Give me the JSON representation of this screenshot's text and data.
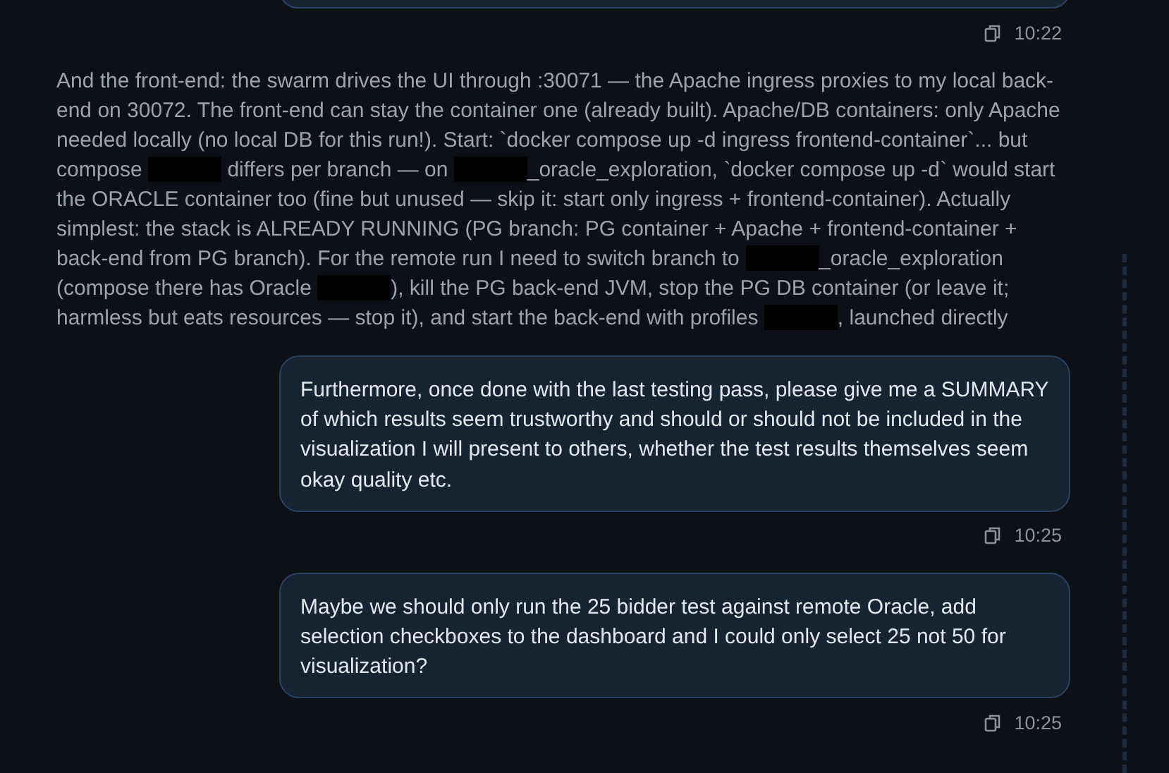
{
  "messages": [
    {
      "kind": "user",
      "cut": true,
      "time": "10:22"
    },
    {
      "kind": "assistant",
      "segments": [
        {
          "kind": "text",
          "text": "And the front-end: the swarm drives the UI through :30071 — the Apache ingress proxies to my local back-end on 30072. The front-end can stay the container one (already built). Apache/DB containers: only Apache needed locally (no local DB for this run!). Start: `docker compose up -d ingress frontend-container`... but compose "
        },
        {
          "kind": "redaction"
        },
        {
          "kind": "text",
          "text": " differs per branch — on "
        },
        {
          "kind": "redaction"
        },
        {
          "kind": "text",
          "text": "_oracle_exploration, `docker compose up -d` would start the ORACLE container too (fine but unused — skip it: start only ingress + frontend-container). Actually simplest: the stack is ALREADY RUNNING (PG branch: PG container + Apache + frontend-container + back-end from PG branch). For the remote run I need to switch branch to "
        },
        {
          "kind": "redaction"
        },
        {
          "kind": "text",
          "text": "_oracle_exploration (compose there has Oracle "
        },
        {
          "kind": "redaction"
        },
        {
          "kind": "text",
          "text": "), kill the PG back-end JVM, stop the PG DB container (or leave it; harmless but eats resources — stop it), and start the back-end with profiles "
        },
        {
          "kind": "redaction"
        },
        {
          "kind": "text",
          "text": ", launched directly"
        }
      ]
    },
    {
      "kind": "user",
      "cut": false,
      "text": "Furthermore, once done with the last testing pass, please give me a SUMMARY of which results seem trustworthy and should or should not be included in the visualization I will present to others, whether the test results themselves seem okay quality etc.",
      "time": "10:25"
    },
    {
      "kind": "user",
      "cut": false,
      "text": "Maybe we should only run the 25 bidder test against remote Oracle, add selection checkboxes to the dashboard and I could only select 25 not 50 for visualization?",
      "time": "10:25"
    }
  ]
}
